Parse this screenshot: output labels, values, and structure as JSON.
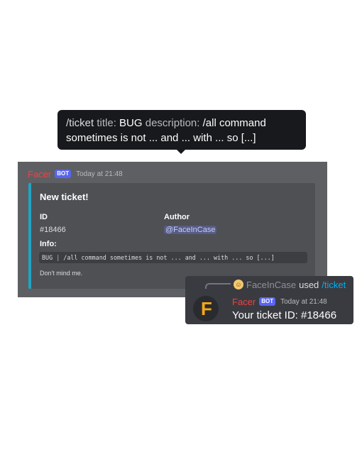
{
  "tooltip": {
    "command": "/ticket",
    "title_label": "title:",
    "title_value": "BUG",
    "description_label": "description:",
    "description_value": "/all command",
    "description_cont": "sometimes is not ... and ... with ... so [...]"
  },
  "message": {
    "author": "Facer",
    "bot_tag": "BOT",
    "timestamp": "Today at 21:48",
    "embed": {
      "accent_color": "#1fa5c4",
      "title": "New ticket!",
      "fields": {
        "id_name": "ID",
        "id_value": "#18466",
        "author_name": "Author",
        "author_value": "@FaceInCase",
        "info_name": "Info:"
      },
      "code": {
        "tag": "BUG",
        "separator": "|",
        "text": "/all command sometimes is not ... and ... with ... so [...]"
      },
      "footer": "Don't mind me."
    }
  },
  "reply": {
    "reference_user": "FaceInCase",
    "used_text": "used",
    "command": "/ticket",
    "author": "Facer",
    "bot_tag": "BOT",
    "timestamp": "Today at 21:48",
    "body": "Your ticket ID: #18466",
    "avatar_letter": "F"
  },
  "colors": {
    "author_red": "#ed4245",
    "blurple": "#5865f2",
    "link_blue": "#00aff4",
    "avatar_orange": "#f5a81a"
  }
}
